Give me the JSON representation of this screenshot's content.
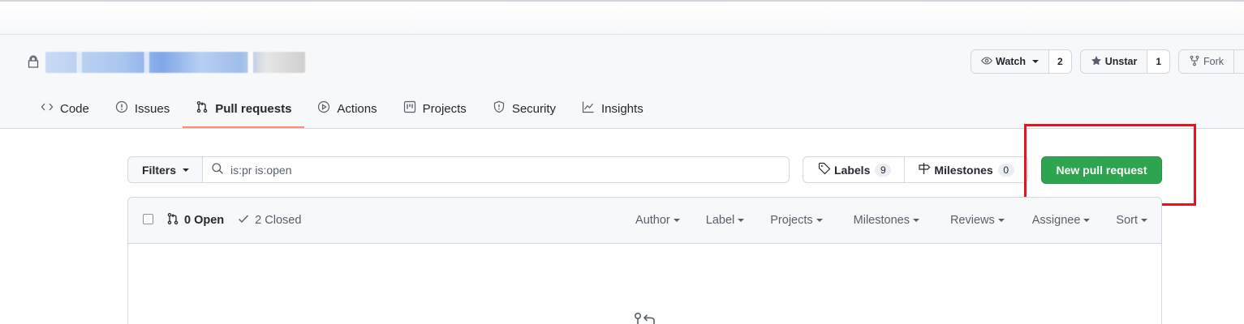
{
  "repo": {
    "title_redacted": ""
  },
  "header_actions": {
    "watch": {
      "label": "Watch",
      "count": "2",
      "icon": "eye-icon"
    },
    "star": {
      "label": "Unstar",
      "count": "1",
      "icon": "star-filled-icon"
    },
    "fork": {
      "label": "Fork",
      "icon": "repo-forked-icon"
    }
  },
  "tabs": [
    {
      "label": "Code",
      "icon": "code-icon",
      "active": false
    },
    {
      "label": "Issues",
      "icon": "issue-opened-icon",
      "active": false
    },
    {
      "label": "Pull requests",
      "icon": "git-pull-request-icon",
      "active": true
    },
    {
      "label": "Actions",
      "icon": "play-icon",
      "active": false
    },
    {
      "label": "Projects",
      "icon": "project-icon",
      "active": false
    },
    {
      "label": "Security",
      "icon": "shield-icon",
      "active": false
    },
    {
      "label": "Insights",
      "icon": "graph-icon",
      "active": false
    }
  ],
  "filters": {
    "button_label": "Filters",
    "search_value": "is:pr is:open"
  },
  "labels": {
    "label": "Labels",
    "count": "9"
  },
  "milestones": {
    "label": "Milestones",
    "count": "0"
  },
  "new_pr_label": "New pull request",
  "list_header": {
    "open_label": "0 Open",
    "closed_label": "2 Closed",
    "menus": [
      "Author",
      "Label",
      "Projects",
      "Milestones",
      "Reviews",
      "Assignee",
      "Sort"
    ]
  },
  "colors": {
    "primary_button": "#2da44e",
    "active_tab_underline": "#fd8c73",
    "highlight": "#e8121c"
  }
}
